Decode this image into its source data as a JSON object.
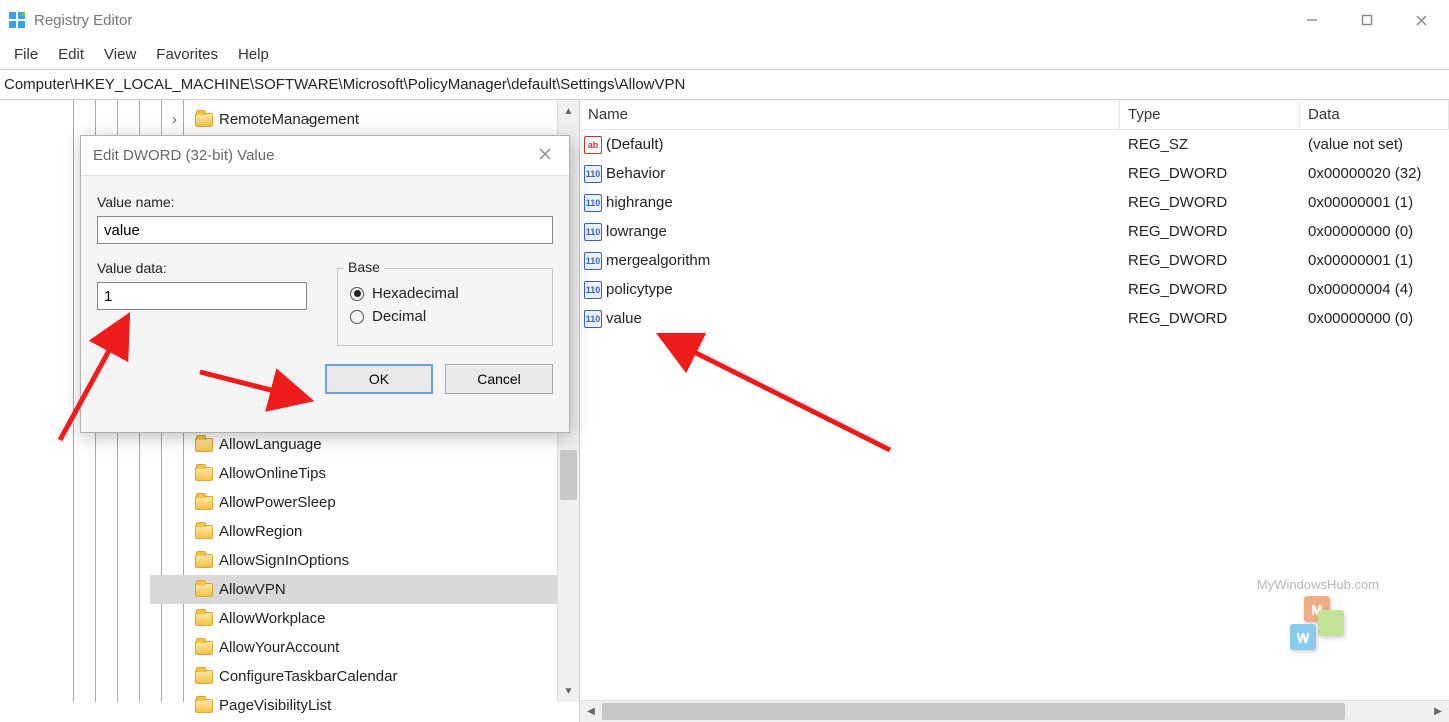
{
  "window": {
    "title": "Registry Editor"
  },
  "menubar": {
    "items": [
      "File",
      "Edit",
      "View",
      "Favorites",
      "Help"
    ]
  },
  "addressbar": {
    "path": "Computer\\HKEY_LOCAL_MACHINE\\SOFTWARE\\Microsoft\\PolicyManager\\default\\Settings\\AllowVPN"
  },
  "tree": {
    "visible_items": [
      {
        "label": "RemoteManagement",
        "expander": true
      },
      {
        "label": "AllowLanguage"
      },
      {
        "label": "AllowOnlineTips"
      },
      {
        "label": "AllowPowerSleep"
      },
      {
        "label": "AllowRegion"
      },
      {
        "label": "AllowSignInOptions"
      },
      {
        "label": "AllowVPN",
        "selected": true
      },
      {
        "label": "AllowWorkplace"
      },
      {
        "label": "AllowYourAccount"
      },
      {
        "label": "ConfigureTaskbarCalendar"
      },
      {
        "label": "PageVisibilityList"
      }
    ]
  },
  "list": {
    "columns": {
      "name": "Name",
      "type": "Type",
      "data": "Data"
    },
    "rows": [
      {
        "icon": "sz",
        "name": "(Default)",
        "type": "REG_SZ",
        "data": "(value not set)"
      },
      {
        "icon": "dw",
        "name": "Behavior",
        "type": "REG_DWORD",
        "data": "0x00000020 (32)"
      },
      {
        "icon": "dw",
        "name": "highrange",
        "type": "REG_DWORD",
        "data": "0x00000001 (1)"
      },
      {
        "icon": "dw",
        "name": "lowrange",
        "type": "REG_DWORD",
        "data": "0x00000000 (0)"
      },
      {
        "icon": "dw",
        "name": "mergealgorithm",
        "type": "REG_DWORD",
        "data": "0x00000001 (1)"
      },
      {
        "icon": "dw",
        "name": "policytype",
        "type": "REG_DWORD",
        "data": "0x00000004 (4)"
      },
      {
        "icon": "dw",
        "name": "value",
        "type": "REG_DWORD",
        "data": "0x00000000 (0)"
      }
    ]
  },
  "dialog": {
    "title": "Edit DWORD (32-bit) Value",
    "value_name_label": "Value name:",
    "value_name": "value",
    "value_data_label": "Value data:",
    "value_data": "1",
    "base_label": "Base",
    "hex_label": "Hexadecimal",
    "dec_label": "Decimal",
    "base_selected": "hex",
    "ok": "OK",
    "cancel": "Cancel"
  },
  "watermark": {
    "text": "MyWindowsHub.com"
  }
}
